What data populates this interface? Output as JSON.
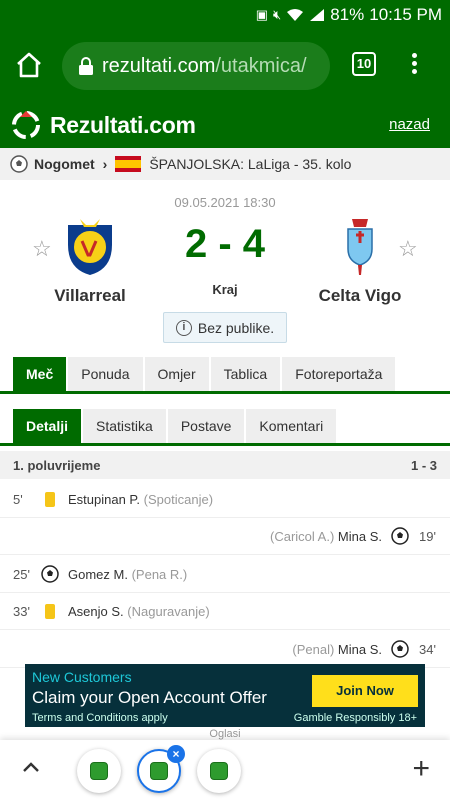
{
  "status_bar": {
    "battery": "81%",
    "time": "10:15 PM"
  },
  "browser": {
    "url_host": "rezultati.com",
    "url_path": "/utakmica/",
    "tab_count": "10"
  },
  "site": {
    "logo_text": "Rezultati.com",
    "back_link": "nazad"
  },
  "breadcrumb": {
    "sport": "Nogomet",
    "league": "ŠPANJOLSKA: LaLiga - 35. kolo"
  },
  "match": {
    "date": "09.05.2021 18:30",
    "home_team": "Villarreal",
    "away_team": "Celta Vigo",
    "score": "2 - 4",
    "status": "Kraj",
    "note": "Bez publike."
  },
  "main_tabs": [
    {
      "label": "Meč",
      "active": true
    },
    {
      "label": "Ponuda",
      "active": false
    },
    {
      "label": "Omjer",
      "active": false
    },
    {
      "label": "Tablica",
      "active": false
    },
    {
      "label": "Fotoreportaža",
      "active": false
    }
  ],
  "sub_tabs": [
    {
      "label": "Detalji",
      "active": true
    },
    {
      "label": "Statistika",
      "active": false
    },
    {
      "label": "Postave",
      "active": false
    },
    {
      "label": "Komentari",
      "active": false
    }
  ],
  "half": {
    "label": "1. poluvrijeme",
    "score": "1 - 3"
  },
  "events": [
    {
      "minute": "5'",
      "side": "home",
      "type": "yellow-card",
      "player": "Estupinan P.",
      "detail": "(Spoticanje)"
    },
    {
      "minute": "19'",
      "side": "away",
      "type": "goal",
      "player": "Mina S.",
      "detail": "(Caricol A.)"
    },
    {
      "minute": "25'",
      "side": "home",
      "type": "goal",
      "player": "Gomez M.",
      "detail": "(Pena R.)"
    },
    {
      "minute": "33'",
      "side": "home",
      "type": "yellow-card",
      "player": "Asenjo S.",
      "detail": "(Naguravanje)"
    },
    {
      "minute": "34'",
      "side": "away",
      "type": "goal",
      "player": "Mina S.",
      "detail": "(Penal)"
    }
  ],
  "ad": {
    "headline": "New Customers",
    "text": "Claim your Open Account Offer",
    "terms": "Terms and Conditions apply",
    "gamble": "Gamble Responsibly 18+",
    "cta": "Join Now",
    "label": "Oglasi"
  },
  "colors": {
    "brand_green": "#006b00",
    "accent_blue": "#1a73e8",
    "yellow_card": "#f5c518"
  }
}
